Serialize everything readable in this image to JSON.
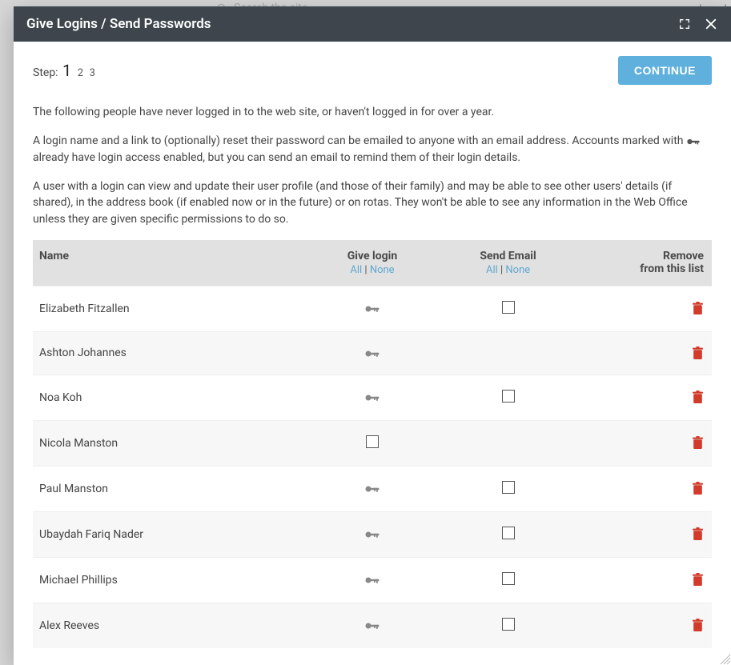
{
  "backdrop": {
    "search_placeholder": "Search the site",
    "brand_fragment": "church"
  },
  "modal": {
    "title": "Give Logins / Send Passwords"
  },
  "steps": {
    "label": "Step: ",
    "s1": "1",
    "s2": "2",
    "s3": "3"
  },
  "buttons": {
    "continue": "CONTINUE"
  },
  "intro": {
    "p1": "The following people have never logged in to the web site, or haven't logged in for over a year.",
    "p2a": "A login name and a link to (optionally) reset their password can be emailed to anyone with an email address. Accounts marked with ",
    "p2b": " already have login access enabled, but you can send an email to remind them of their login details.",
    "p3": "A user with a login can view and update their user profile (and those of their family) and may be able to see other users' details (if shared), in the address book (if enabled now or in the future) or on rotas. They won't be able to see any information in the Web Office unless they are given specific permissions to do so."
  },
  "table": {
    "headers": {
      "name": "Name",
      "give_login": "Give login",
      "send_email": "Send Email",
      "remove_line1": "Remove",
      "remove_line2": "from this list"
    },
    "allnone": {
      "all": "All",
      "sep": " | ",
      "none": "None"
    },
    "rows": [
      {
        "name": "Elizabeth Fitzallen",
        "has_login": true,
        "email_checkbox": true
      },
      {
        "name": "Ashton Johannes",
        "has_login": true,
        "email_checkbox": false
      },
      {
        "name": "Noa Koh",
        "has_login": true,
        "email_checkbox": true
      },
      {
        "name": "Nicola Manston",
        "has_login": false,
        "email_checkbox": false
      },
      {
        "name": "Paul Manston",
        "has_login": true,
        "email_checkbox": true
      },
      {
        "name": "Ubaydah Fariq Nader",
        "has_login": true,
        "email_checkbox": true
      },
      {
        "name": "Michael Phillips",
        "has_login": true,
        "email_checkbox": true
      },
      {
        "name": "Alex Reeves",
        "has_login": true,
        "email_checkbox": true
      }
    ]
  }
}
